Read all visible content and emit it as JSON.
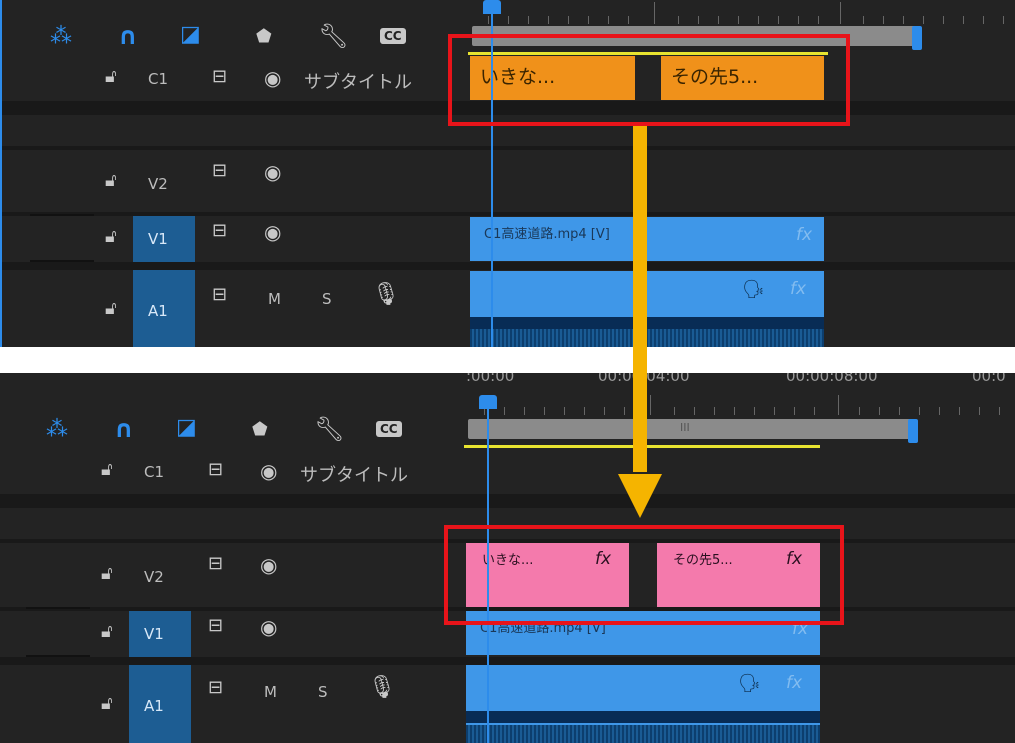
{
  "top": {
    "track_header": {
      "c1_label": "C1",
      "subtitle_label": "サブタイトル",
      "v2_label": "V2",
      "v1_label": "V1",
      "a1_label": "A1",
      "m_label": "M",
      "s_label": "S",
      "cc_label": "CC"
    },
    "caption_clips": [
      {
        "label": "いきな..."
      },
      {
        "label": "その先5..."
      }
    ],
    "v1_clip": {
      "label": "C1高速道路.mp4 [V]",
      "fx": "fx"
    },
    "a1_clip": {
      "fx": "fx"
    }
  },
  "bottom": {
    "timecodes": [
      ":00:00",
      "00:00:04:00",
      "00:00:08:00",
      "00:0"
    ],
    "scroll_mark": "III",
    "track_header": {
      "c1_label": "C1",
      "subtitle_label": "サブタイトル",
      "v2_label": "V2",
      "v1_label": "V1",
      "a1_label": "A1",
      "m_label": "M",
      "s_label": "S",
      "cc_label": "CC"
    },
    "graphic_clips": [
      {
        "label": "いきな...",
        "fx": "fx"
      },
      {
        "label": "その先5...",
        "fx": "fx"
      }
    ],
    "v1_clip": {
      "label": "C1高速道路.mp4 [V]",
      "fx": "fx"
    },
    "a1_clip": {
      "fx": "fx"
    }
  },
  "colors": {
    "accent": "#2d8ceb",
    "caption": "#f0911a",
    "graphic": "#f47aac",
    "clip": "#3f97e8",
    "highlight": "#e8141a",
    "arrow": "#f5b400"
  }
}
